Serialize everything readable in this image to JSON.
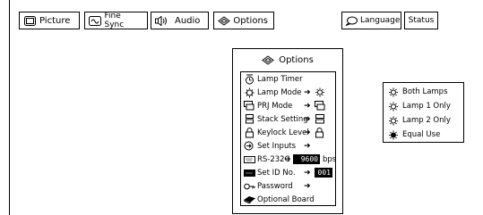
{
  "tabs": [
    {
      "label": "Picture",
      "icon": "picture-icon"
    },
    {
      "label": "Fine Sync",
      "icon": "fine-sync-icon"
    },
    {
      "label": "Audio",
      "icon": "audio-icon"
    },
    {
      "label": "Options",
      "icon": "options-icon"
    },
    {
      "label": "Language",
      "icon": "language-icon"
    },
    {
      "label": "Status",
      "icon": ""
    }
  ],
  "options_panel": {
    "title": "Options",
    "items": [
      {
        "label": "Lamp Timer",
        "icon": "lamp-timer-icon"
      },
      {
        "label": "Lamp Mode",
        "icon": "lamp-mode-icon",
        "arrow": "➜",
        "value_icon": "lamp-icon"
      },
      {
        "label": "PRJ Mode",
        "icon": "prj-mode-icon",
        "arrow": "➜",
        "value_icon": "prj-icon"
      },
      {
        "label": "Stack Setting",
        "icon": "stack-setting-icon",
        "arrow": "➜",
        "value_icon": "stack-icon"
      },
      {
        "label": "Keylock Level",
        "icon": "keylock-icon",
        "arrow": "➜",
        "value_icon": "lock-icon"
      },
      {
        "label": "Set Inputs",
        "icon": "set-inputs-icon",
        "arrow": "➜"
      },
      {
        "label": "RS-232C",
        "icon": "rs232c-icon",
        "arrow": "➜",
        "value": "9600",
        "unit": "bps"
      },
      {
        "label": "Set ID No.",
        "icon": "set-id-icon",
        "arrow": "➜",
        "value": "001"
      },
      {
        "label": "Password",
        "icon": "password-icon",
        "arrow": "➜"
      },
      {
        "label": "Optional Board",
        "icon": "optional-board-icon"
      }
    ]
  },
  "lamp_submenu": {
    "items": [
      {
        "label": "Both Lamps",
        "icon": "both-lamps-icon"
      },
      {
        "label": "Lamp 1 Only",
        "icon": "lamp-1-icon"
      },
      {
        "label": "Lamp 2 Only",
        "icon": "lamp-2-icon"
      },
      {
        "label": "Equal Use",
        "icon": "equal-use-icon"
      }
    ]
  }
}
